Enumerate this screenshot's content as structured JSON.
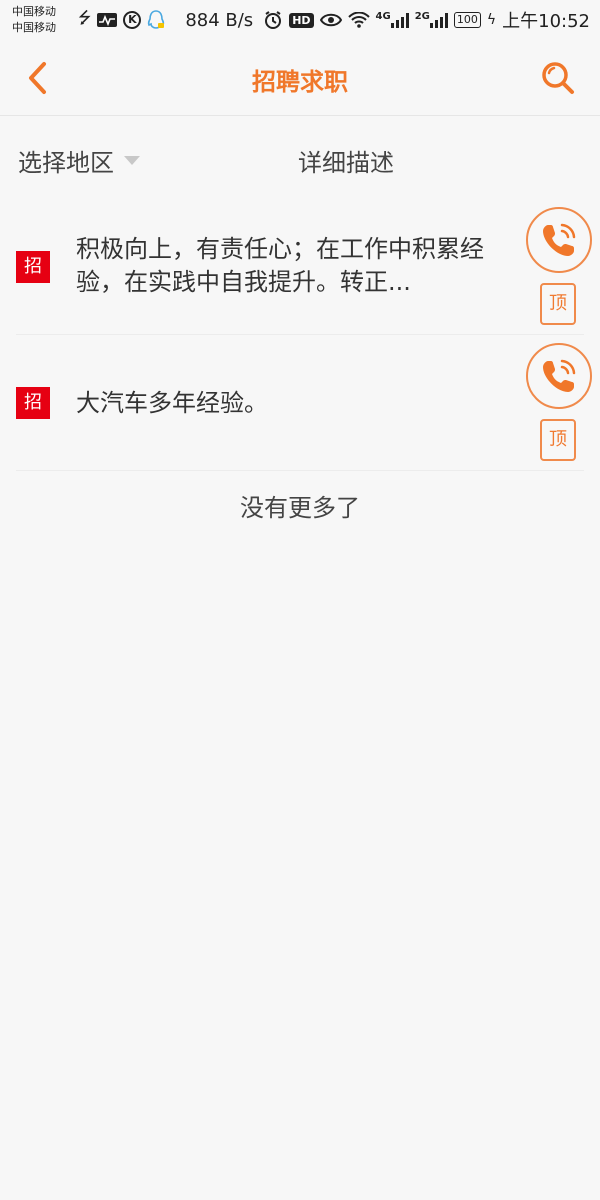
{
  "status_bar": {
    "carrier_1": "中国移动",
    "carrier_2": "中国移动",
    "speed": "884 B/s",
    "hd_badge": "HD",
    "net_4g": "4G",
    "net_2g": "2G",
    "battery": "100",
    "time": "上午10:52",
    "k_icon": "K"
  },
  "header": {
    "title": "招聘求职"
  },
  "filter": {
    "region_label": "选择地区",
    "detail_label": "详细描述"
  },
  "listings": [
    {
      "tag": "招",
      "text": "积极向上，有责任心；在工作中积累经验，在实践中自我提升。转正...",
      "top_label": "顶"
    },
    {
      "tag": "招",
      "text": "大汽车多年经验。",
      "top_label": "顶"
    }
  ],
  "footer": {
    "no_more": "没有更多了"
  },
  "colors": {
    "accent": "#f0772a",
    "tag_red": "#e60012",
    "background": "#f7f7f7"
  },
  "icons": {
    "back": "chevron-left-icon",
    "search": "search-icon",
    "call": "phone-icon"
  }
}
